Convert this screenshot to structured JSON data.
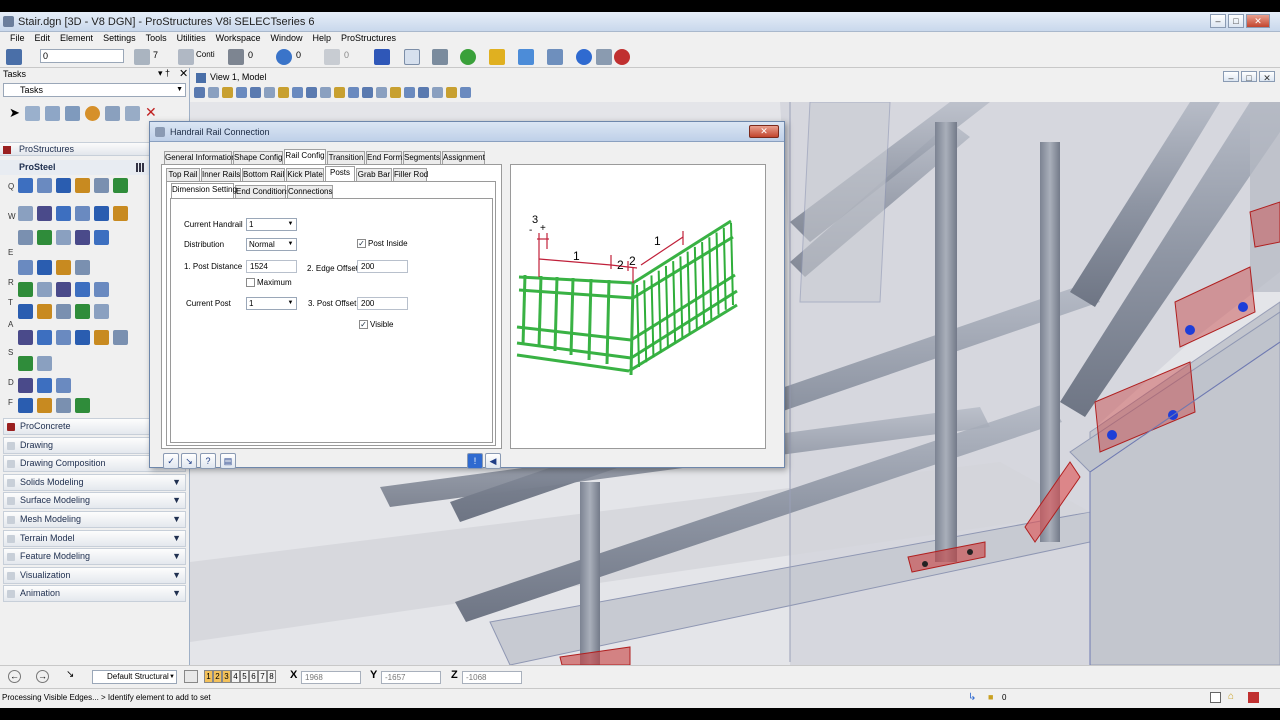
{
  "window": {
    "title": "Stair.dgn [3D - V8 DGN] - ProStructures V8i SELECTseries 6"
  },
  "menu": [
    "File",
    "Edit",
    "Element",
    "Settings",
    "Tools",
    "Utilities",
    "Workspace",
    "Window",
    "Help",
    "ProStructures"
  ],
  "toolbar": {
    "level_value": "0",
    "color_value": "7",
    "style_value": "Conti",
    "weight_value": "0",
    "transparency_value": "0",
    "priority_value": "0"
  },
  "tasks": {
    "title": "Tasks",
    "dropdown": "Tasks",
    "prostructures_label": "ProStructures",
    "prosteel_label": "ProSteel",
    "row_letters": [
      "Q",
      "W",
      "E",
      "R",
      "T",
      "A",
      "S",
      "D",
      "F"
    ],
    "sections": [
      "ProConcrete",
      "Drawing",
      "Drawing Composition",
      "Solids Modeling",
      "Surface Modeling",
      "Mesh Modeling",
      "Terrain Model",
      "Feature Modeling",
      "Visualization",
      "Animation"
    ]
  },
  "view": {
    "title": "View 1, Model"
  },
  "dialog": {
    "title": "Handrail Rail Connection",
    "main_tabs": [
      "General Information",
      "Shape Config",
      "Rail Config",
      "Transition",
      "End Form",
      "Segments",
      "Assignment"
    ],
    "rail_tabs": [
      "Top Rail",
      "Inner Rails",
      "Bottom Rail",
      "Kick Plate",
      "Posts",
      "Grab Bar",
      "Filler Rod"
    ],
    "posts_tabs": [
      "Dimension Setting",
      "End Conditions",
      "Connections"
    ],
    "fields": {
      "current_handrail_label": "Current Handrail",
      "current_handrail_value": "1",
      "distribution_label": "Distribution",
      "distribution_value": "Normal",
      "post_inside_label": "Post Inside",
      "post_distance_label": "1. Post Distance",
      "post_distance_value": "1524",
      "edge_offset_label": "2. Edge Offset",
      "edge_offset_value": "200",
      "maximum_label": "Maximum",
      "current_post_label": "Current Post",
      "current_post_value": "1",
      "post_offset_label": "3. Post Offset",
      "post_offset_value": "200",
      "visible_label": "Visible"
    },
    "preview_labels": {
      "d1": "1",
      "d2": "2",
      "d3": "3",
      "d1b": "1",
      "d2b": "2",
      "minus": "-",
      "plus": "+"
    }
  },
  "status": {
    "view_buttons": [
      "1",
      "2",
      "3",
      "4",
      "5",
      "6",
      "7",
      "8"
    ],
    "default_label": "Default Structural",
    "x_label": "X",
    "x_value": "1968",
    "y_label": "Y",
    "y_value": "-1657",
    "z_label": "Z",
    "z_value": "-1068",
    "message": "Processing Visible Edges... > Identify element to add to set",
    "lock_value": "0"
  },
  "colors": {
    "accent": "#1f3d86",
    "rail_green": "#2fae3a",
    "dimension_red": "#c0203a",
    "plate_red": "#c84040",
    "bolt_blue": "#1e3ed8"
  }
}
